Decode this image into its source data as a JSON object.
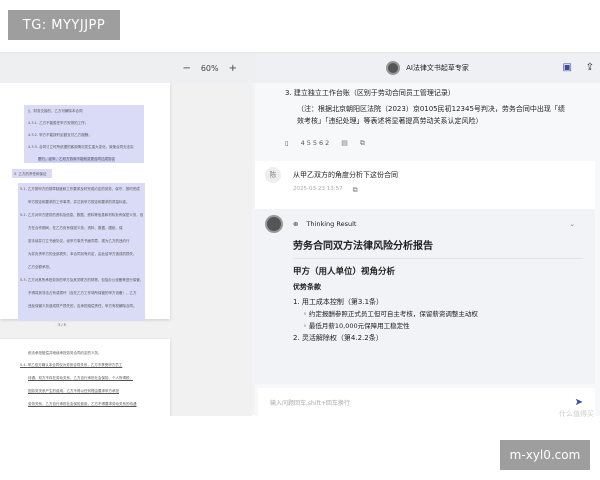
{
  "watermarks": {
    "tg": "TG: MYYJJPP",
    "site": "m-xyl0.com",
    "smzdm": "什么值得买"
  },
  "toolbar": {
    "zoom_out": "−",
    "zoom": "60%",
    "zoom_in": "+"
  },
  "doc": {
    "page1": [
      "፮、财务交接的，乙方可解除本合同",
      "4.3.1. 乙方不能胜任甲方安排的工作；",
      "4.3.2. 甲方不能按时足额支付乙方报酬；",
      "4.3.3. 合同订立时所依据的客观情况发生重大变化，致使合同无法实",
      "履行，经甲、乙双方协商不能就变更合同达成协议",
      "5. 乙方的责任和保证",
      "5.1. 乙方按甲方的规章制度和工作要求及时完成约定的劳务，保守、按时完成",
      "甲方规定和要求的工作事项，并达到甲方规定和要求的质量标准。",
      "5.2. 乙方对甲方提供的资料及信息、数据、资料等信息和材料负有保密义务，双",
      "方在合作期间，在乙方负有保密义务，资料、数据、图纸，保",
      "密手续并订立书面协议，经甲方事先书面同意，视为乙方的违约行",
      "为并负责甲方的全部损失，本合同另有约定，由此给甲方造成的损失，",
      "乙方全额承担。",
      "5.3. 乙方对其所承担劳务的甲方及其关联方的财物，包括办公设备等进行保管，",
      "不得将其非法占有或损坏（含在乙方工作场所保管的甲方设备），乙方",
      "违反保管义务造成财产损失的，应承担赔偿责任，甲方有权解除合同。"
    ],
    "page_num": "3 / 5",
    "page2": [
      "依法承担赔偿并继续承担劳务合同约定的义务。",
      "5.4. 甲乙双方确认本合同仅为劳务合同关系，乙方不享受甲方员工",
      "待遇，双方不存在劳动关系，乙方自行承担社会保险、个人所得税，",
      "因劳务关系产生的费用，乙方不得以任何理由要求甲方承担",
      "劳务关系，乙方自行承担社会保险费用，乙方不得要求劳动关系的待遇"
    ]
  },
  "chat": {
    "title": "AI法律文书起草专家",
    "prev_item": "3.  建立独立工作台账（区别于劳动合同员工管理记录）",
    "prev_note": "（注：根据北京朝阳区法院（2023）京0105民初12345号判决，劳务合同中出现「绩效考核」「违纪处理」等表述将显著提高劳动关系认定风险）",
    "prev_count": "45562",
    "user_initial": "陈",
    "user_msg": "从甲乙双方的角度分析下这份合同",
    "user_time": "2025-03-23 13:57",
    "thinking_label": "Thinking Result",
    "report_title": "劳务合同双方法律风险分析报告",
    "section_title": "甲方（用人单位）视角分析",
    "sub_title": "优势条款",
    "item1": "1.  用工成本控制（第3.1条）",
    "bullets": [
      "约定报酬参照正式员工但可自主考核，保留薪资调整主动权",
      "最低月薪10,000元保障用工稳定性"
    ],
    "item2": "2.  灵活解除权（第4.2.2条）",
    "input_placeholder": "输入问题回车,shift+回车换行"
  }
}
